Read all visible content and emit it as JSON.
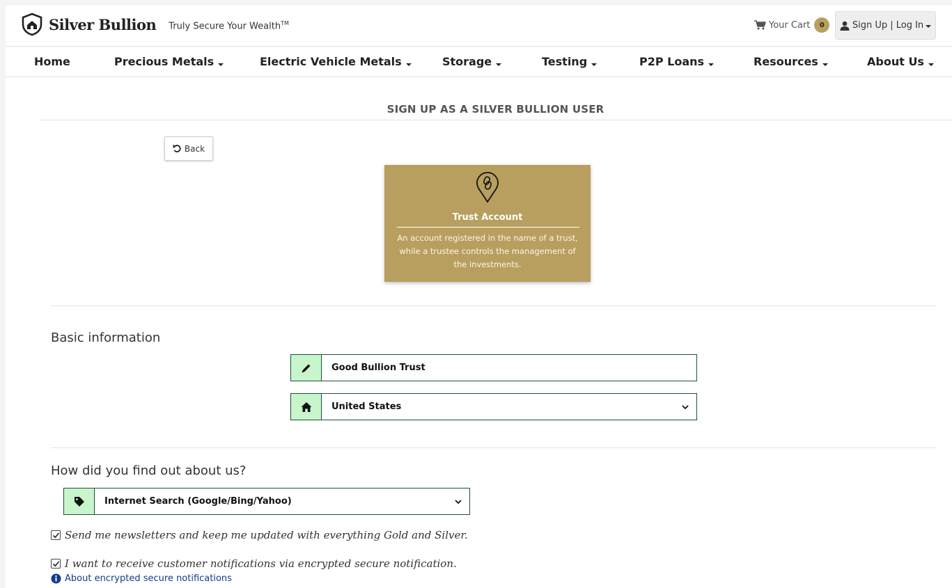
{
  "header": {
    "brand": "Silver Bullion",
    "tagline": "Truly Secure Your Wealth",
    "tagline_mark": "TM",
    "cart_label": "Your Cart",
    "cart_count": "0",
    "account_label": "Sign Up | Log In"
  },
  "nav": {
    "items": [
      {
        "label": "Home",
        "dropdown": false
      },
      {
        "label": "Precious Metals",
        "dropdown": true
      },
      {
        "label": "Electric Vehicle Metals",
        "dropdown": true
      },
      {
        "label": "Storage",
        "dropdown": true
      },
      {
        "label": "Testing",
        "dropdown": true
      },
      {
        "label": "P2P Loans",
        "dropdown": true
      },
      {
        "label": "Resources",
        "dropdown": true
      },
      {
        "label": "About Us",
        "dropdown": true
      }
    ]
  },
  "page": {
    "title": "SIGN UP AS A SILVER BULLION USER",
    "back_label": "Back"
  },
  "account_type": {
    "icon": "chain-link-pin-icon",
    "title": "Trust Account",
    "description": "An account registered in the name of a trust, while a trustee controls the management of the investments."
  },
  "basic_info": {
    "heading": "Basic information",
    "trust_name": "Good Bullion Trust",
    "country": "United States"
  },
  "referral": {
    "heading": "How did you find out about us?",
    "selected": "Internet Search (Google/Bing/Yahoo)"
  },
  "options": {
    "newsletter_label": "Send me newsletters and keep me updated with everything Gold and Silver.",
    "newsletter_checked": true,
    "notifications_label": "I want to receive customer notifications via encrypted secure notification.",
    "notifications_checked": true,
    "info_link": "About encrypted secure notifications"
  },
  "colors": {
    "gold": "#b89f5f",
    "addon_green": "#c8f5cc",
    "border_dark_green": "#1f4f3b",
    "link_blue": "#123b8c"
  }
}
